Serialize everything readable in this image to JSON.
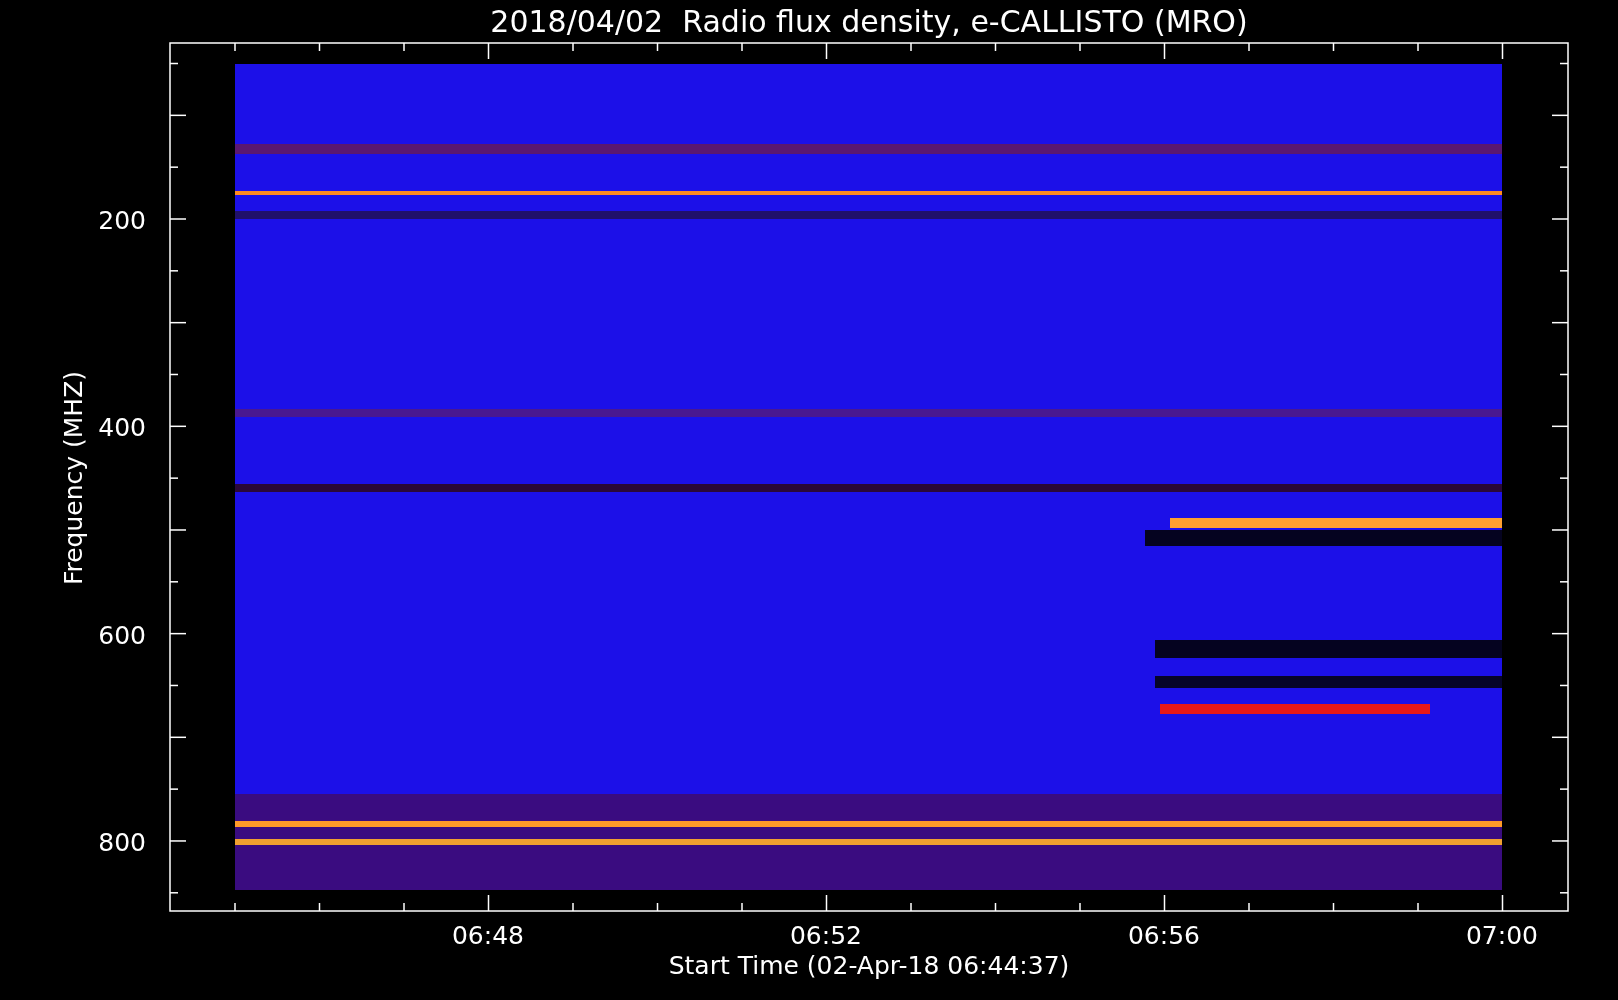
{
  "plot": {
    "title": "2018/04/02  Radio flux density, e-CALLISTO (MRO)",
    "ylabel": "Frequency (MHZ)",
    "xlabel": "Start Time (02-Apr-18 06:44:37)",
    "y_tick_labels": [
      "200",
      "400",
      "600",
      "800"
    ],
    "x_tick_labels": [
      "06:48",
      "06:52",
      "06:56",
      "07:00"
    ]
  }
}
